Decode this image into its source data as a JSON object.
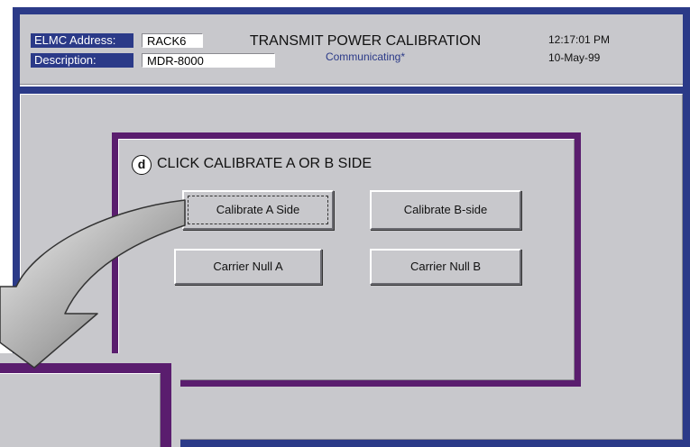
{
  "header": {
    "address_label": "ELMC Address:",
    "address_value": "RACK6",
    "description_label": "Description:",
    "description_value": "MDR-8000",
    "title": "TRANSMIT POWER CALIBRATION",
    "status": "Communicating*",
    "time": "12:17:01 PM",
    "date": "10-May-99"
  },
  "dialog": {
    "step_letter": "d",
    "instruction": "CLICK CALIBRATE A OR B SIDE",
    "buttons": {
      "calibrate_a": "Calibrate A Side",
      "calibrate_b": "Calibrate B-side",
      "carrier_null_a": "Carrier Null A",
      "carrier_null_b": "Carrier Null B"
    }
  },
  "colors": {
    "frame_blue": "#2b3a88",
    "dialog_purple": "#5a1d6e",
    "panel_gray": "#c8c8cc"
  }
}
